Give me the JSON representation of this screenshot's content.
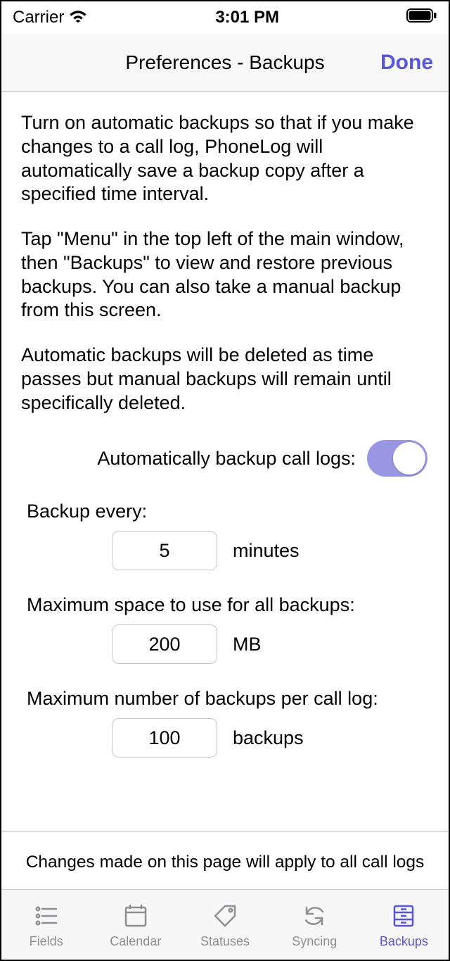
{
  "status_bar": {
    "carrier": "Carrier",
    "time": "3:01 PM"
  },
  "nav": {
    "title": "Preferences - Backups",
    "done": "Done"
  },
  "description": {
    "p1": "Turn on automatic backups so that if you make changes to a call log, PhoneLog will automatically save a backup copy after a specified time interval.",
    "p2": "Tap \"Menu\" in the top left of the main window, then \"Backups\" to view and restore previous backups. You can also take a manual backup from this screen.",
    "p3": "Automatic backups will be deleted as time passes but manual backups will remain until specifically deleted."
  },
  "toggle": {
    "label": "Automatically backup call logs:",
    "value": true
  },
  "settings": {
    "backup_every": {
      "label": "Backup every:",
      "value": "5",
      "unit": "minutes"
    },
    "max_space": {
      "label": "Maximum space to use for all backups:",
      "value": "200",
      "unit": "MB"
    },
    "max_number": {
      "label": "Maximum number of backups per call log:",
      "value": "100",
      "unit": "backups"
    }
  },
  "footer_note": "Changes made on this page will apply to all call logs",
  "tabs": {
    "fields": "Fields",
    "calendar": "Calendar",
    "statuses": "Statuses",
    "syncing": "Syncing",
    "backups": "Backups"
  },
  "colors": {
    "accent": "#5856d6",
    "toggle_on": "#9997e4",
    "inactive_gray": "#8e8e93"
  }
}
